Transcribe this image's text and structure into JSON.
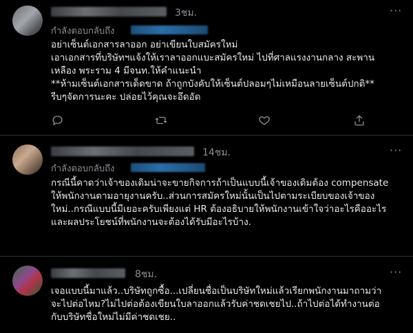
{
  "tweets": [
    {
      "time": "3ชม.",
      "reply_prefix": "กำลังตอบกลับถึง",
      "lines": [
        "อย่าเซ็นต์เอกสารลาออก อย่าเขียนใบสมัครใหม่",
        "เอาเอกสารที่บริษัทฯแจ้งให้เราลาออกแบะสมัครใหม่ ไปที่ศาลแรงงานกลาง สะพาน",
        "เหลือง พระราม 4 มีจนท.ให้คำแนะนำ",
        "**ห้ามเซ็นต์เอกสารเด็ดขาด ถ้าถูกบังคับให้เซ็นต์ปลอมๆไม่เหมือนลายเซ็นต์ปกติ**",
        "รีบๆจัดการนะคะ ปล่อยไว้คุณจะอึดอัด"
      ]
    },
    {
      "time": "14ชม.",
      "reply_prefix": "กำลังตอบกลับถึง",
      "lines": [
        "กรณีนี้คาดว่าเจ้าของเดิมน่าจะขายกิจการถ้าเป็นแบบนี้เจ้าของเดิมต้อง compensate",
        "ให้พนักงานตามอายุงานครับ..ส่วนการสมัครใหม่นั้นเป็นไปตามระเบียบของเจ้าของ",
        "ใหม่..กรณีแบบนี้มีเยอะครับเพียงแต่ HR ต้องอธิบายให้พนักงานเข้าใจว่าอะไรคืออะไร",
        "และผลประโยชน์ที่พนักงานจะต้องได้รับมีอะไรบ้าง."
      ]
    },
    {
      "time": "8ชม.",
      "lines": [
        "เจอแบบนี้มาแล้ว..บริษัทถูกซื้อ...เปลี่ยนชื่อเป็นบริษัทใหม่แล้วเรียกพนักงานมาถามว่า",
        "จะไปต่อไหม?ไม่ไปต่อต้องเขียนใบลาออกแล้วรับค่าชดเชยไป..ถ้าไปต่อได้ทำงานต่อ",
        "กับบริษัทชื่อใหม่ไม่มีค่าชดเชย.."
      ]
    }
  ],
  "icons": [
    "avatar",
    "more-icon",
    "reply-icon",
    "retweet-icon",
    "like-icon",
    "share-icon"
  ],
  "colors": {
    "background": "#000000",
    "text": "#e7e9ea",
    "muted": "#8b8f94",
    "link": "#1d9bf0"
  }
}
